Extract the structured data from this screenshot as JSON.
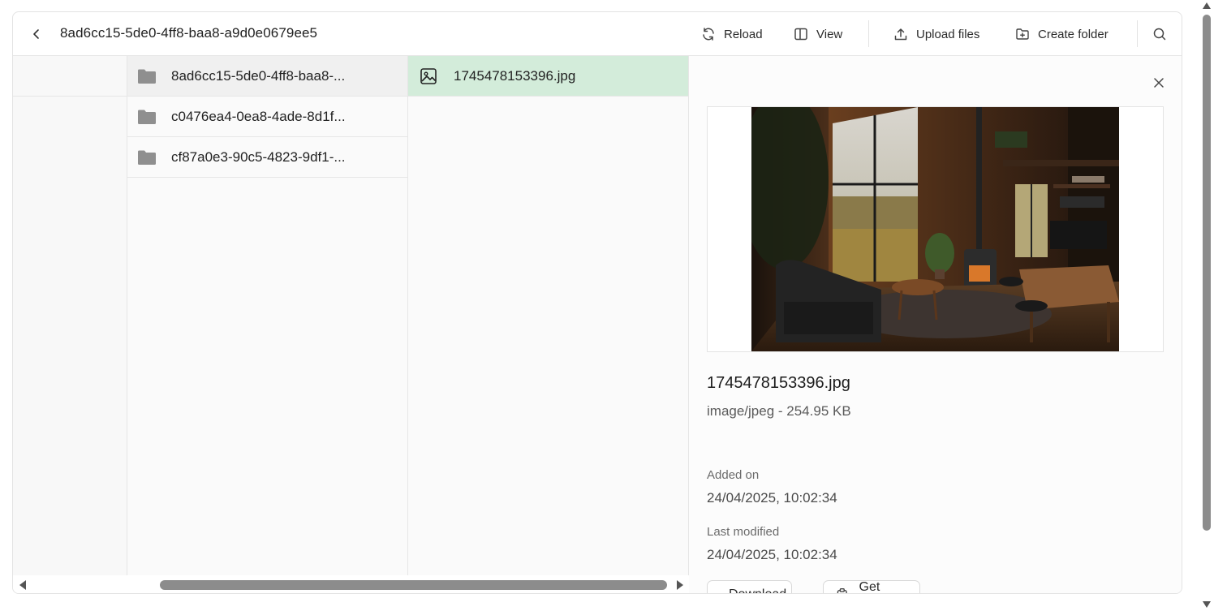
{
  "header": {
    "path": "8ad6cc15-5de0-4ff8-baa8-a9d0e0679ee5",
    "back_icon": "chevron-left-icon",
    "toolbar": {
      "reload": "Reload",
      "view": "View",
      "upload": "Upload files",
      "create_folder": "Create folder"
    }
  },
  "folders": [
    {
      "name": "8ad6cc15-5de0-4ff8-baa8-..."
    },
    {
      "name": "c0476ea4-0ea8-4ade-8d1f..."
    },
    {
      "name": "cf87a0e3-90c5-4823-9df1-..."
    }
  ],
  "files": [
    {
      "name": "1745478153396.jpg",
      "icon": "image-icon"
    }
  ],
  "detail": {
    "filename": "1745478153396.jpg",
    "meta": "image/jpeg - 254.95 KB",
    "added_label": "Added on",
    "added_value": "24/04/2025, 10:02:34",
    "modified_label": "Last modified",
    "modified_value": "24/04/2025, 10:02:34",
    "download": "Download",
    "get_url": "Get URL"
  },
  "colors": {
    "selected_row": "#d3ecda",
    "folder_icon": "#8f8f8f"
  }
}
